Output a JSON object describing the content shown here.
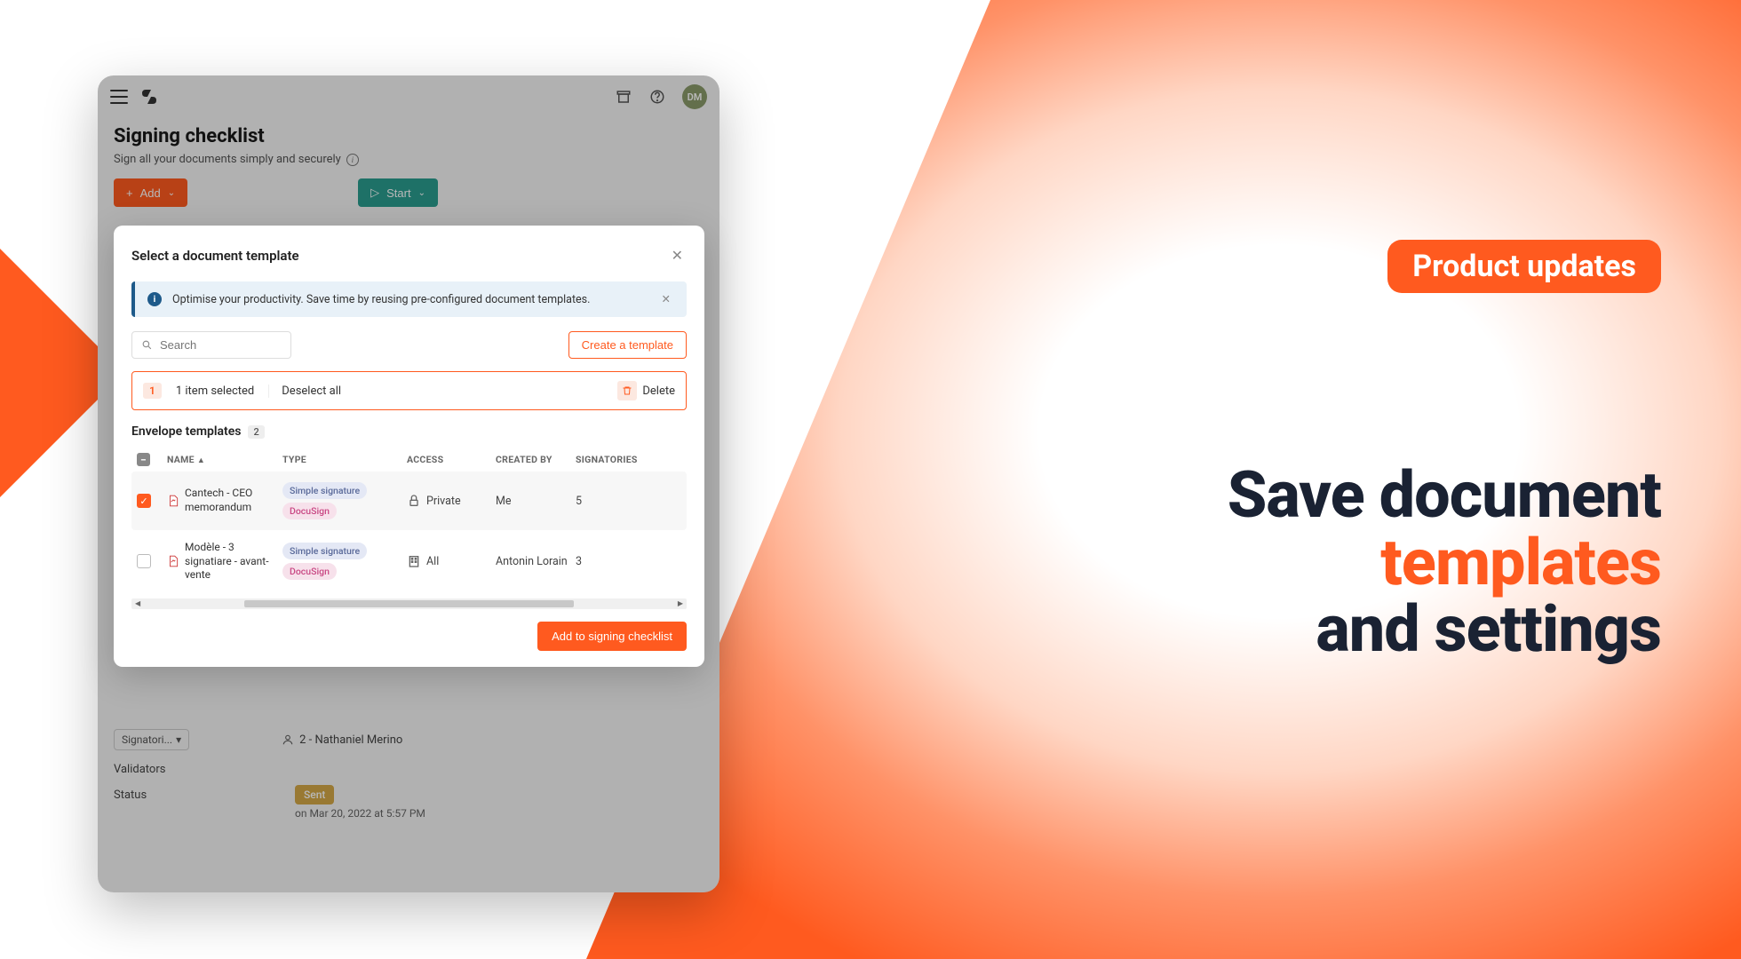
{
  "marketing": {
    "badge": "Product updates",
    "line1": "Save document",
    "line2_accent": "templates",
    "line3": "and settings"
  },
  "topbar": {
    "avatar_initials": "DM"
  },
  "page": {
    "title": "Signing checklist",
    "subtitle": "Sign all your documents simply and securely"
  },
  "buttons": {
    "add": "Add",
    "start": "Start"
  },
  "below": {
    "signatories_label": "Signatori...",
    "signer2": "2 - Nathaniel Merino",
    "validators_label": "Validators",
    "status_label": "Status",
    "sent": "Sent",
    "sent_on": "on Mar 20, 2022 at 5:57 PM"
  },
  "modal": {
    "title": "Select a document template",
    "banner": "Optimise your productivity. Save time by reusing pre-configured document templates.",
    "search_placeholder": "Search",
    "create_template": "Create a template",
    "sel_count": "1",
    "sel_text": "1 item selected",
    "deselect": "Deselect all",
    "delete": "Delete",
    "section_title": "Envelope templates",
    "section_count": "2",
    "cols": {
      "name": "NAME",
      "type": "TYPE",
      "access": "ACCESS",
      "created_by": "CREATED BY",
      "signatories": "SIGNATORIES"
    },
    "rows": [
      {
        "name": "Cantech - CEO memorandum",
        "tags": [
          "Simple signature",
          "DocuSign"
        ],
        "access": "Private",
        "access_icon": "lock",
        "created_by": "Me",
        "signatories": "5",
        "checked": true
      },
      {
        "name": "Modèle - 3 signatiare - avant-vente",
        "tags": [
          "Simple signature",
          "DocuSign"
        ],
        "access": "All",
        "access_icon": "building",
        "created_by": "Antonin Lorain",
        "signatories": "3",
        "checked": false
      }
    ],
    "footer_btn": "Add to signing checklist"
  }
}
